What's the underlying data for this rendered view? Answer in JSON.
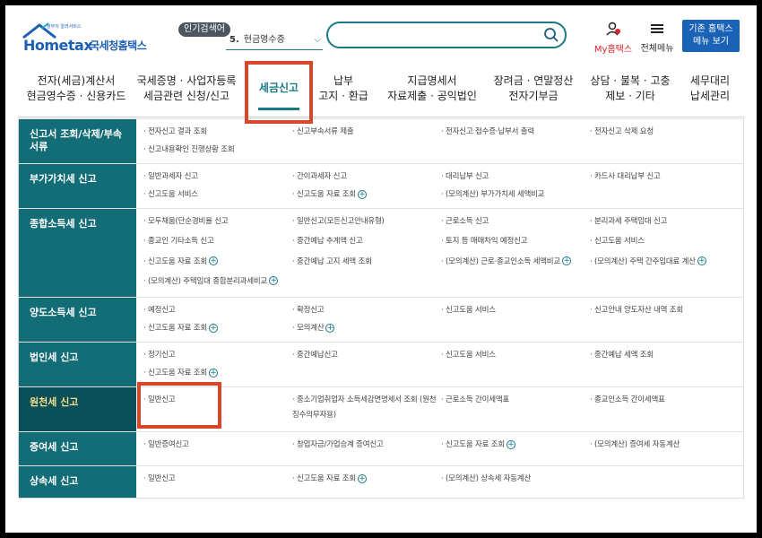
{
  "header": {
    "logo_tagline": "정부의 알려서비스",
    "logo_brand": "Hometax",
    "logo_brand_kr": "국세청홈택스",
    "popular_badge": "인기검색어",
    "popular_rank": "5.",
    "popular_term": "현금영수증",
    "search_placeholder": "",
    "my_label": "My홈택스",
    "all_menu_label": "전체메뉴",
    "legacy_line1": "기존 홈택스",
    "legacy_line2": "메뉴 보기"
  },
  "nav": [
    {
      "line1": "전자(세금)계산서",
      "line2": "현금영수증 · 신용카드"
    },
    {
      "line1": "국세증명 · 사업자등록",
      "line2": "세금관련 신청/신고"
    },
    {
      "line1": "세금신고",
      "line2": "",
      "active": true
    },
    {
      "line1": "납부",
      "line2": "고지 · 환급"
    },
    {
      "line1": "지급명세서",
      "line2": "자료제출 · 공익법인"
    },
    {
      "line1": "장려금 · 연말정산",
      "line2": "전자기부금"
    },
    {
      "line1": "상담 · 불복 · 고충",
      "line2": "제보 · 기타"
    },
    {
      "line1": "세무대리",
      "line2": "납세관리"
    }
  ],
  "rows": [
    {
      "label": "신고서 조회/삭제/부속서류",
      "items": [
        {
          "text": "· 전자신고 결과 조회"
        },
        {
          "text": "· 신고부속서류 제출"
        },
        {
          "text": "· 전자신고 접수증·납부서 출력"
        },
        {
          "text": "· 전자신고 삭제 요청"
        },
        {
          "text": "· 신고내용확인 진행상황 조회"
        }
      ]
    },
    {
      "label": "부가가치세 신고",
      "items": [
        {
          "text": "· 일반과세자 신고"
        },
        {
          "text": "· 간이과세자 신고"
        },
        {
          "text": "· 대리납부 신고"
        },
        {
          "text": "· 카드사 대리납부 신고"
        },
        {
          "text": "· 신고도움 서비스"
        },
        {
          "text": "· 신고도움 자료 조회",
          "plus": true
        },
        {
          "text": "· (모의계산) 부가가치세 세액비교"
        }
      ]
    },
    {
      "label": "종합소득세 신고",
      "items": [
        {
          "text": "· 모두채움(단순경비율 신고"
        },
        {
          "text": "· 일반신고(모든신고안내유형)"
        },
        {
          "text": "· 근로소득 신고"
        },
        {
          "text": "· 분리과세 주택임대 신고"
        },
        {
          "text": "· 종교인 기타소득 신고"
        },
        {
          "text": "· 중간예납 추계액 신고"
        },
        {
          "text": "· 토지 등 매매차익 예정신고"
        },
        {
          "text": "· 신고도움 서비스"
        },
        {
          "text": "· 신고도움 자료 조회",
          "plus": true
        },
        {
          "text": "· 중간예납 고지 세액 조회"
        },
        {
          "text": "· (모의계산) 근로·종교인소득 세액비교",
          "plus": true
        },
        {
          "text": "· (모의계산) 주택 간주임대료 계산",
          "plus": true
        },
        {
          "text": "· (모의계산) 주택임대 종합분리과세비교",
          "plus": true
        }
      ]
    },
    {
      "label": "양도소득세 신고",
      "items": [
        {
          "text": "· 예정신고"
        },
        {
          "text": "· 확정신고"
        },
        {
          "text": "· 신고도움 서비스"
        },
        {
          "text": "· 신고안내 양도자산 내역 조회"
        },
        {
          "text": "· 신고도움 자료 조회",
          "plus": true
        },
        {
          "text": "· 모의계산",
          "plus": true
        }
      ]
    },
    {
      "label": "법인세 신고",
      "items": [
        {
          "text": "· 정기신고"
        },
        {
          "text": "· 중간예납신고"
        },
        {
          "text": "· 신고도움 서비스"
        },
        {
          "text": "· 중간예납 세액 조회"
        },
        {
          "text": "· 신고도움 자료 조회",
          "plus": true
        }
      ]
    },
    {
      "label": "원천세 신고",
      "selected": true,
      "items": [
        {
          "text": "· 일반신고"
        },
        {
          "text": "· 중소기업취업자 소득세감면명세서 조회 (원천징수의무자용)"
        },
        {
          "text": "· 근로소득 간이세액표"
        },
        {
          "text": "· 종교인소득 간이세액표"
        }
      ]
    },
    {
      "label": "증여세 신고",
      "items": [
        {
          "text": "· 일반증여신고"
        },
        {
          "text": "· 창업자금/가업승계 증여신고"
        },
        {
          "text": "· 신고도움 자료 조회",
          "plus": true
        },
        {
          "text": "· (모의계산) 증여세 자동계산"
        }
      ]
    },
    {
      "label": "상속세 신고",
      "items": [
        {
          "text": "· 일반신고"
        },
        {
          "text": "· 신고도움 자료 조회",
          "plus": true
        },
        {
          "text": "· (모의계산) 상속세 자동계산"
        }
      ]
    }
  ],
  "colors": {
    "accent": "#126d77",
    "highlight_box": "#d9472b",
    "selected_label": "#f4e18a"
  }
}
